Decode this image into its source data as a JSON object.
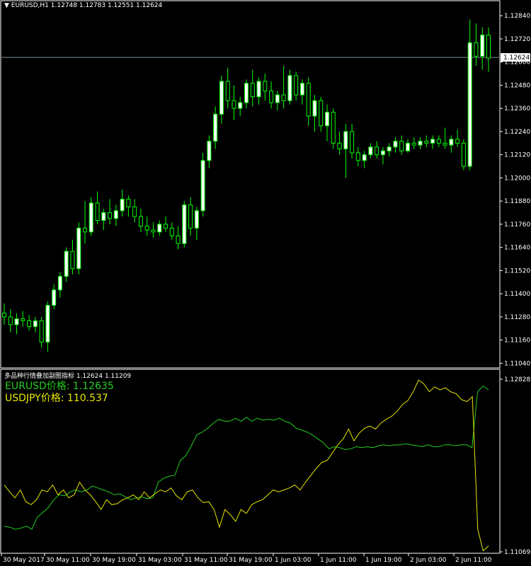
{
  "header": {
    "symbol_timeframe": "EURUSD,H1",
    "ohlc": "1.12748 1.12783 1.12551 1.12624"
  },
  "colors": {
    "background": "#000000",
    "candle": "#00ff00",
    "candle_body_bull": "#ffffff",
    "grid": "#4d4d4d",
    "price_line": "#778899",
    "eurusd_line": "#22cc22",
    "usdjpy_line": "#e6e600",
    "axis_text": "#ffffff"
  },
  "chart_data": [
    {
      "type": "candlestick",
      "title": "EURUSD,H1",
      "price_axis_ticks": [
        "1.12840",
        "1.12720",
        "1.12600",
        "1.12480",
        "1.12360",
        "1.12240",
        "1.12120",
        "1.12000",
        "1.11880",
        "1.11760",
        "1.11640",
        "1.11520",
        "1.11400",
        "1.11280",
        "1.11160",
        "1.11040"
      ],
      "ylim": [
        1.11016,
        1.1287
      ],
      "current_price_label": "1.12624",
      "current_price": 1.12624,
      "candles": [
        [
          1.113,
          1.1135,
          1.1124,
          1.1128
        ],
        [
          1.1128,
          1.1132,
          1.112,
          1.1124
        ],
        [
          1.1124,
          1.113,
          1.1119,
          1.1127
        ],
        [
          1.1127,
          1.1131,
          1.1123,
          1.1126
        ],
        [
          1.1126,
          1.1129,
          1.1121,
          1.1123
        ],
        [
          1.1123,
          1.1128,
          1.112,
          1.1126
        ],
        [
          1.1126,
          1.1128,
          1.1112,
          1.1115
        ],
        [
          1.1115,
          1.1136,
          1.111,
          1.1134
        ],
        [
          1.1134,
          1.1145,
          1.1132,
          1.1142
        ],
        [
          1.1142,
          1.1151,
          1.1138,
          1.1149
        ],
        [
          1.1149,
          1.1164,
          1.1146,
          1.1162
        ],
        [
          1.1162,
          1.1168,
          1.115,
          1.1153
        ],
        [
          1.1153,
          1.1177,
          1.115,
          1.1174
        ],
        [
          1.1174,
          1.1188,
          1.1166,
          1.1172
        ],
        [
          1.1172,
          1.119,
          1.117,
          1.1187
        ],
        [
          1.1187,
          1.1193,
          1.1176,
          1.1178
        ],
        [
          1.1178,
          1.1184,
          1.1173,
          1.1182
        ],
        [
          1.1182,
          1.1189,
          1.1176,
          1.1179
        ],
        [
          1.1179,
          1.1186,
          1.1175,
          1.1183
        ],
        [
          1.1183,
          1.1194,
          1.118,
          1.1189
        ],
        [
          1.1189,
          1.1191,
          1.118,
          1.1185
        ],
        [
          1.1185,
          1.1189,
          1.1177,
          1.118
        ],
        [
          1.118,
          1.1184,
          1.1172,
          1.1175
        ],
        [
          1.1175,
          1.118,
          1.117,
          1.1173
        ],
        [
          1.1173,
          1.1177,
          1.1169,
          1.1172
        ],
        [
          1.1172,
          1.1178,
          1.117,
          1.1176
        ],
        [
          1.1176,
          1.118,
          1.1172,
          1.1174
        ],
        [
          1.1174,
          1.1177,
          1.1168,
          1.117
        ],
        [
          1.117,
          1.1175,
          1.1163,
          1.1166
        ],
        [
          1.1166,
          1.1188,
          1.1164,
          1.1186
        ],
        [
          1.1186,
          1.119,
          1.117,
          1.1174
        ],
        [
          1.1174,
          1.1185,
          1.1168,
          1.1183
        ],
        [
          1.1183,
          1.1213,
          1.118,
          1.1209
        ],
        [
          1.1209,
          1.1222,
          1.1205,
          1.1219
        ],
        [
          1.1219,
          1.1237,
          1.1215,
          1.1233
        ],
        [
          1.1233,
          1.1253,
          1.1228,
          1.125
        ],
        [
          1.125,
          1.1257,
          1.1236,
          1.124
        ],
        [
          1.124,
          1.1248,
          1.123,
          1.1236
        ],
        [
          1.1236,
          1.1242,
          1.1232,
          1.1239
        ],
        [
          1.1239,
          1.1251,
          1.1236,
          1.1249
        ],
        [
          1.1249,
          1.1256,
          1.1237,
          1.1242
        ],
        [
          1.1242,
          1.1252,
          1.1238,
          1.125
        ],
        [
          1.125,
          1.1254,
          1.124,
          1.1245
        ],
        [
          1.1245,
          1.125,
          1.1236,
          1.1239
        ],
        [
          1.1239,
          1.1245,
          1.1235,
          1.1243
        ],
        [
          1.1243,
          1.1258,
          1.1236,
          1.124
        ],
        [
          1.124,
          1.1256,
          1.1238,
          1.1253
        ],
        [
          1.1253,
          1.1255,
          1.124,
          1.1243
        ],
        [
          1.1243,
          1.1251,
          1.1238,
          1.1249
        ],
        [
          1.1249,
          1.1252,
          1.1227,
          1.1232
        ],
        [
          1.1232,
          1.1243,
          1.1224,
          1.124
        ],
        [
          1.124,
          1.1242,
          1.1224,
          1.1227
        ],
        [
          1.1227,
          1.1238,
          1.1219,
          1.1234
        ],
        [
          1.1234,
          1.1236,
          1.1215,
          1.1218
        ],
        [
          1.1218,
          1.1224,
          1.1212,
          1.1215
        ],
        [
          1.1215,
          1.1228,
          1.12,
          1.1224
        ],
        [
          1.1224,
          1.1228,
          1.121,
          1.1213
        ],
        [
          1.1213,
          1.1216,
          1.1206,
          1.1209
        ],
        [
          1.1209,
          1.1214,
          1.1205,
          1.1212
        ],
        [
          1.1212,
          1.1218,
          1.121,
          1.1216
        ],
        [
          1.1216,
          1.1219,
          1.121,
          1.1212
        ],
        [
          1.1212,
          1.1216,
          1.1207,
          1.1214
        ],
        [
          1.1214,
          1.1218,
          1.1211,
          1.1216
        ],
        [
          1.1216,
          1.1221,
          1.1213,
          1.1219
        ],
        [
          1.1219,
          1.1222,
          1.1212,
          1.1214
        ],
        [
          1.1214,
          1.122,
          1.1213,
          1.1218
        ],
        [
          1.1218,
          1.1221,
          1.1215,
          1.1217
        ],
        [
          1.1217,
          1.1221,
          1.1215,
          1.1219
        ],
        [
          1.1219,
          1.1222,
          1.1216,
          1.1218
        ],
        [
          1.1218,
          1.1222,
          1.1215,
          1.122
        ],
        [
          1.122,
          1.1222,
          1.1216,
          1.1218
        ],
        [
          1.1218,
          1.1226,
          1.1215,
          1.1217
        ],
        [
          1.1217,
          1.1222,
          1.1213,
          1.122
        ],
        [
          1.122,
          1.1225,
          1.1216,
          1.1218
        ],
        [
          1.1218,
          1.122,
          1.1204,
          1.1206
        ],
        [
          1.1206,
          1.1282,
          1.1204,
          1.127
        ],
        [
          1.127,
          1.128,
          1.1258,
          1.1263
        ],
        [
          1.1263,
          1.1278,
          1.1256,
          1.1274
        ],
        [
          1.1274,
          1.1278,
          1.1255,
          1.1262
        ]
      ],
      "x_tick_labels": [
        "30 May 2017",
        "30 May 11:00",
        "30 May 19:00",
        "31 May 03:00",
        "31 May 11:00",
        "31 May 19:00",
        "1 Jun 03:00",
        "1 Jun 11:00",
        "1 Jun 19:00",
        "2 Jun 03:00",
        "2 Jun 11:00"
      ],
      "grid": false
    },
    {
      "type": "line",
      "title": "多品种行情叠加副图指标 1.12624 1.11209",
      "price_axis_ticks": [
        "1.12828",
        "1.11069"
      ],
      "ylim": [
        1.11069,
        1.12828
      ],
      "series": [
        {
          "name": "EURUSD价格: 1.12635",
          "values": [
            1.1133,
            1.1132,
            1.113,
            1.1131,
            1.1133,
            1.113,
            1.1142,
            1.1147,
            1.1152,
            1.116,
            1.1165,
            1.1164,
            1.1168,
            1.117,
            1.1168,
            1.117,
            1.1174,
            1.1172,
            1.117,
            1.1168,
            1.1165,
            1.1166,
            1.1163,
            1.116,
            1.1162,
            1.1163,
            1.1161,
            1.1162,
            1.1178,
            1.1182,
            1.1184,
            1.1185,
            1.12,
            1.1205,
            1.1215,
            1.1226,
            1.1229,
            1.1233,
            1.1238,
            1.1242,
            1.124,
            1.124,
            1.1243,
            1.124,
            1.1244,
            1.124,
            1.1243,
            1.1241,
            1.1242,
            1.1241,
            1.1243,
            1.124,
            1.1238,
            1.1233,
            1.1231,
            1.1229,
            1.1226,
            1.1222,
            1.1218,
            1.1212,
            1.1214,
            1.1213,
            1.1211,
            1.1212,
            1.1214,
            1.1213,
            1.1214,
            1.1213,
            1.1215,
            1.1216,
            1.1215,
            1.1216,
            1.1216,
            1.1217,
            1.1216,
            1.1215,
            1.1214,
            1.1216,
            1.1214,
            1.1214,
            1.1216,
            1.1216,
            1.1215,
            1.1216,
            1.1216,
            1.1213,
            1.127,
            1.1276,
            1.1272
          ]
        },
        {
          "name": "USDJPY价格: 110.537",
          "values": [
            1.1175,
            1.1168,
            1.1162,
            1.117,
            1.1158,
            1.1155,
            1.116,
            1.117,
            1.1168,
            1.1175,
            1.1165,
            1.117,
            1.1162,
            1.1165,
            1.1178,
            1.117,
            1.1165,
            1.1158,
            1.115,
            1.116,
            1.1155,
            1.1156,
            1.116,
            1.1162,
            1.1165,
            1.116,
            1.1168,
            1.1162,
            1.1166,
            1.117,
            1.1168,
            1.1172,
            1.1164,
            1.116,
            1.1168,
            1.117,
            1.1162,
            1.1157,
            1.1158,
            1.115,
            1.1132,
            1.115,
            1.1145,
            1.1138,
            1.115,
            1.1146,
            1.1155,
            1.1158,
            1.116,
            1.1165,
            1.117,
            1.1168,
            1.117,
            1.1172,
            1.1175,
            1.117,
            1.1178,
            1.1185,
            1.1192,
            1.1198,
            1.12,
            1.1208,
            1.1216,
            1.1222,
            1.1232,
            1.122,
            1.1228,
            1.1233,
            1.1235,
            1.1232,
            1.1238,
            1.1242,
            1.1245,
            1.125,
            1.1257,
            1.1261,
            1.127,
            1.1282,
            1.1278,
            1.127,
            1.1275,
            1.1272,
            1.1274,
            1.127,
            1.1268,
            1.1262,
            1.126,
            1.1265,
            1.113,
            1.1108,
            1.1113
          ]
        }
      ],
      "x_tick_labels": [
        "30 May 2017",
        "30 May 11:00",
        "30 May 19:00",
        "31 May 03:00",
        "31 May 11:00",
        "31 May 19:00",
        "1 Jun 03:00",
        "1 Jun 11:00",
        "1 Jun 19:00",
        "2 Jun 03:00",
        "2 Jun 11:00"
      ],
      "legend_placement": "top-left"
    }
  ],
  "legend": {
    "eurusd_label": "EURUSD价格: 1.12635",
    "usdjpy_label": "USDJPY价格: 110.537"
  }
}
